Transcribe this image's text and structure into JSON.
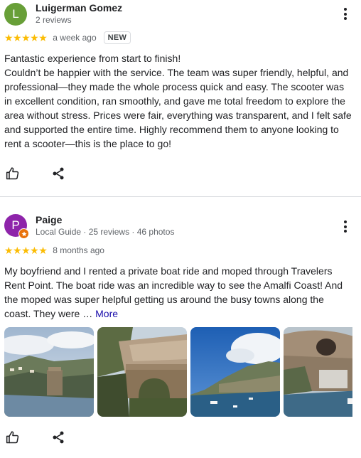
{
  "reviews": [
    {
      "reviewer_name": "Luigerman Gomez",
      "avatar_letter": "L",
      "avatar_color": "#689f38",
      "meta": "2 reviews",
      "stars": "★★★★★",
      "rating": 5,
      "time": "a week ago",
      "badge": "NEW",
      "text": "Fantastic experience from start to finish!\nCouldn’t be happier with the service. The team was super friendly, helpful, and professional—they made the whole process quick and easy. The scooter was in excellent condition, ran smoothly, and gave me total freedom to explore the area without stress. Prices were fair, everything was transparent, and I felt safe and supported the entire time. Highly recommend them to anyone looking to rent a scooter—this is the place to go!"
    },
    {
      "reviewer_name": "Paige",
      "avatar_letter": "P",
      "avatar_color": "#8e24aa",
      "meta": "Local Guide · 25 reviews · 46 photos",
      "stars": "★★★★★",
      "rating": 5,
      "time": "8 months ago",
      "text": "My boyfriend and I rented a private boat ride and moped through Travelers Rent Point. The boat ride was an incredible way to see the Amalfi Coast! And the moped was super helpful getting us around the busy towns along the coast. They were …",
      "more_label": "More"
    }
  ],
  "colors": {
    "star": "#fbbc04",
    "link": "#1a0dab",
    "secondary_text": "#5f6368",
    "local_guide_badge": "#e8710a"
  },
  "icons": {
    "menu": "more-vert-icon",
    "like": "thumb-up-icon",
    "share": "share-icon",
    "guide": "local-guide-star-icon"
  }
}
